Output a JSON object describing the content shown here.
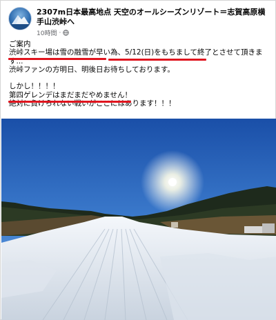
{
  "post": {
    "page_name": "2307m日本最高地点 天空のオールシーズンリゾート＝志賀高原横手山渋峠へ",
    "timestamp": "10時間",
    "privacy_icon": "globe-icon",
    "lines": [
      "ご案内",
      "渋峠スキー場は雪の融雪が早い為、5/12(日)をもちまして終了とさせて頂きま",
      "す...",
      "渋峠ファンの方明日、明後日お待ちしております。",
      "",
      "しかし！！！！",
      "第四ゲレンデはまだまだやめません！",
      "絶対に負けられない戦いがここにはあります！！！"
    ]
  },
  "colors": {
    "underline": "#e0141e",
    "sky_top": "#1a4fa8",
    "snow": "#eef2f7"
  }
}
